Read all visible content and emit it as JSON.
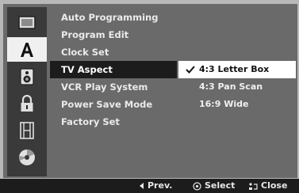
{
  "menu": {
    "items": [
      {
        "label": "Auto Programming"
      },
      {
        "label": "Program Edit"
      },
      {
        "label": "Clock Set"
      },
      {
        "label": "TV Aspect"
      },
      {
        "label": "VCR Play System"
      },
      {
        "label": "Power Save Mode"
      },
      {
        "label": "Factory Set"
      }
    ],
    "selected_index": 3
  },
  "rail": {
    "icons": [
      "tv-icon",
      "letter-a-icon",
      "speaker-icon",
      "lock-icon",
      "film-icon",
      "disc-icon"
    ],
    "selected_index": 1
  },
  "options": {
    "items": [
      {
        "label": "4:3 Letter Box",
        "checked": true
      },
      {
        "label": "4:3 Pan Scan",
        "checked": false
      },
      {
        "label": "16:9 Wide",
        "checked": false
      }
    ]
  },
  "footer": {
    "prev_label": "Prev.",
    "select_label": "Select",
    "close_label": "Close"
  },
  "colors": {
    "panel": "#6a6a6a",
    "rail": "#3a3a3a",
    "highlight_dark": "#1c1c1c",
    "highlight_light": "#ffffff"
  }
}
